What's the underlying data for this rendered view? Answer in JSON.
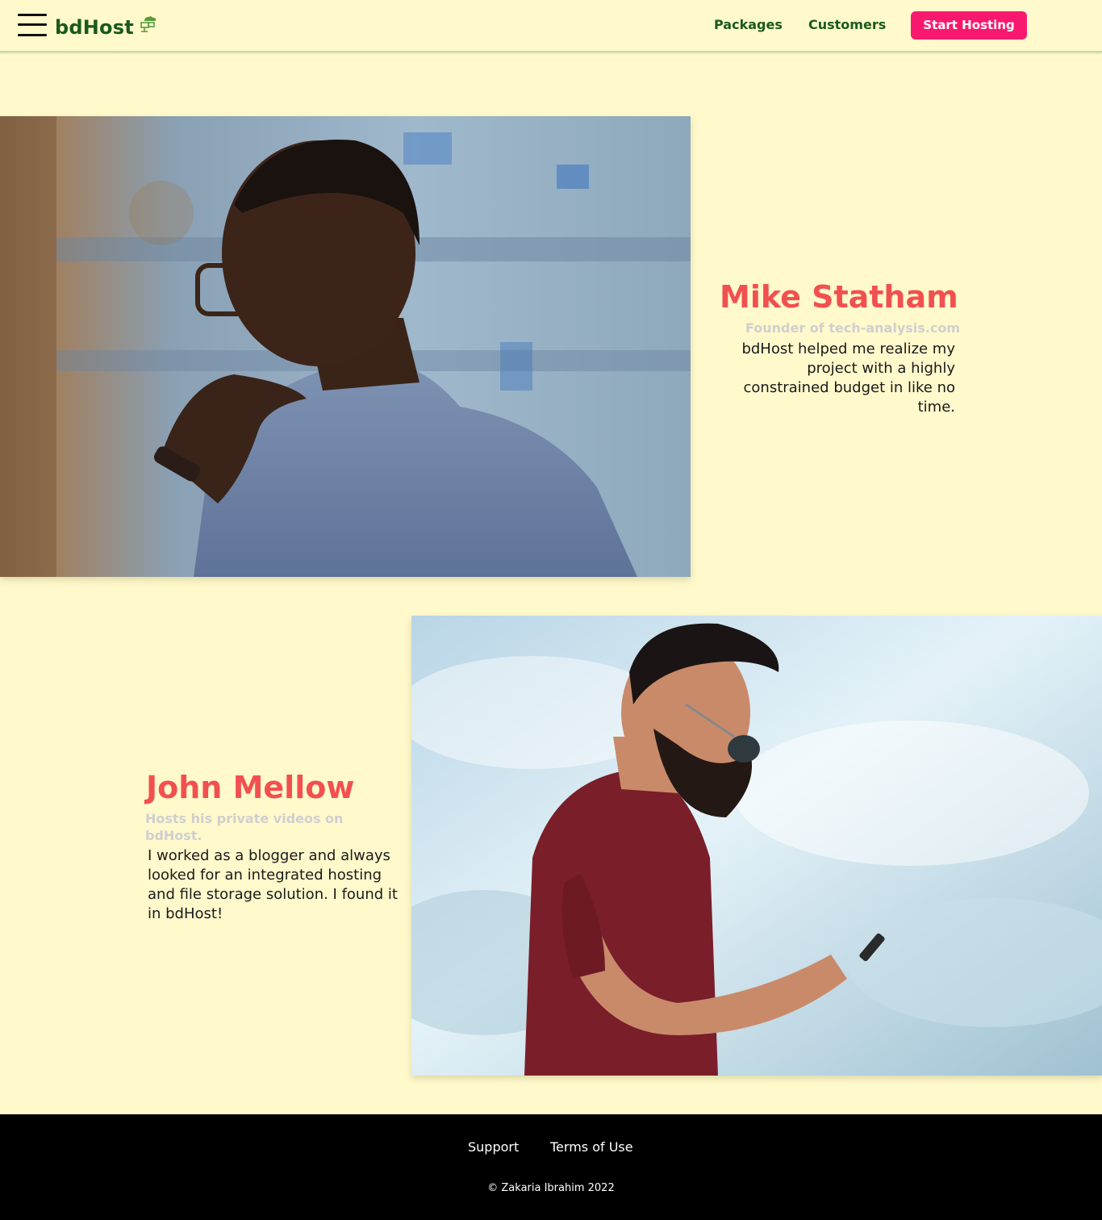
{
  "header": {
    "brand": "bdHost",
    "nav": {
      "packages": "Packages",
      "customers": "Customers"
    },
    "cta_label": "Start Hosting"
  },
  "testimonials": [
    {
      "name": "Mike Statham",
      "role": "Founder of tech-analysis.com",
      "quote": "bdHost helped me realize my project with a highly constrained budget in like no time."
    },
    {
      "name": "John Mellow",
      "role": "Hosts his private videos on bdHost.",
      "quote": "I worked as a blogger and always looked for an integrated hosting and file storage solution. I found it in bdHost!"
    }
  ],
  "footer": {
    "support": "Support",
    "terms": "Terms of Use",
    "copyright": "© Zakaria Ibrahim 2022"
  },
  "colors": {
    "background": "#fff9cc",
    "brand_green": "#1a5a1a",
    "cta_pink": "#f8196e",
    "name_red": "#f25050",
    "role_grey": "#cfcfcf",
    "footer_bg": "#000000"
  }
}
